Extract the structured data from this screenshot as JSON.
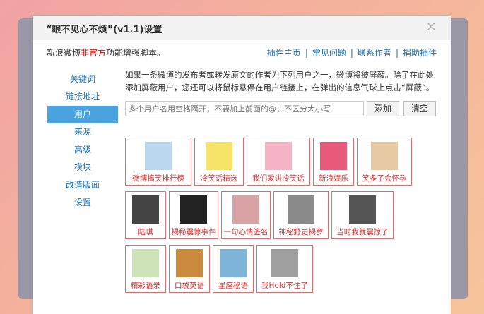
{
  "dialog": {
    "title": "“眼不见心不烦”(v1.1)设置",
    "close_glyph": "✕"
  },
  "topbar": {
    "desc_prefix": "新浪微博",
    "desc_highlight": "非官方",
    "desc_suffix": "功能增强脚本。",
    "links": [
      "插件主页",
      "常见问题",
      "联系作者",
      "捐助插件"
    ],
    "separator": "|"
  },
  "sidebar": {
    "items": [
      "关键词",
      "链接地址",
      "用户",
      "来源",
      "高级",
      "模块",
      "改造版面",
      "设置"
    ],
    "active_index": 2
  },
  "content": {
    "intro": "如果一条微博的发布者或转发原文的作者为下列用户之一，微博将被屏蔽。除了在此处添加屏蔽用户，您还可以将鼠标悬停在用户链接上，在弹出的信息气球上点击“屏蔽”。",
    "input_placeholder": "多个用户名用空格隔开；不要加上前面的@；不区分大小写",
    "add_label": "添加",
    "clear_label": "清空"
  },
  "blocked_users": [
    {
      "name": "微博搞笑排行榜",
      "color": "#b9d7ef"
    },
    {
      "name": "冷笑话精选",
      "color": "#f5e36a"
    },
    {
      "name": "我们爱讲冷笑话",
      "color": "#f4b4c6"
    },
    {
      "name": "新浪娱乐",
      "color": "#e85a7a"
    },
    {
      "name": "笑多了会怀孕",
      "color": "#e7c9a3"
    },
    {
      "name": "陆琪",
      "color": "#444444"
    },
    {
      "name": "揭秘震惊事件",
      "color": "#222222"
    },
    {
      "name": "一句心情签名",
      "color": "#d9a3a6"
    },
    {
      "name": "神秘野史揭罗",
      "color": "#8a8a8a"
    },
    {
      "name": "当时我就震惊了",
      "color": "#555555"
    },
    {
      "name": "精彩语录",
      "color": "#cfe3b9"
    },
    {
      "name": "口袋英语",
      "color": "#c98a3d"
    },
    {
      "name": "星座秘语",
      "color": "#7fb4d9"
    },
    {
      "name": "我Hold不住了",
      "color": "#9f9f9f"
    }
  ]
}
